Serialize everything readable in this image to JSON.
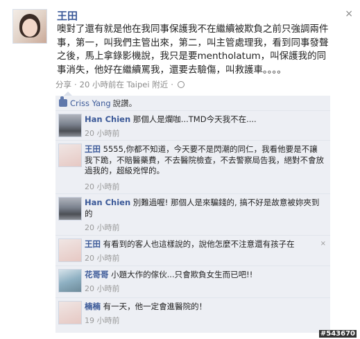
{
  "post": {
    "author": "王田",
    "body": "噢對了還有就是他在我同事保護我不在繼續被欺負之前只強調兩件事，第一，叫我們主管出來，第二，叫主管處理我，看到同事發聲之後，馬上拿錄影機說，我只是要mentholatum，叫保護我的同事消失，他好在繼續罵我，還要去驗傷，叫救護車。。。。",
    "share_label": "分享",
    "separator": "·",
    "time": "20 小時前在 Taipei 附近",
    "close_icon": "×"
  },
  "likes": {
    "name": "Criss Yang",
    "text": "說讚。"
  },
  "comments": [
    {
      "author": "Han Chien",
      "text": "那個人是爛咖...TMD今天我不在....",
      "time": "20 小時前",
      "avatar": "road-photo"
    },
    {
      "author": "王田",
      "text": "5555,你都不知道，今天要不是閃潮的同仁，我看他要是不讓我下跪，不賠醫藥費，不去醫院檢查，不去警察局告我，絕對不會放過我的，超級兇悍的。",
      "time": "20 小時前",
      "avatar": "girl-photo"
    },
    {
      "author": "Han Chien",
      "text": "別難過喔! 那個人是來騙錢的, 搞不好是故意被妳夾到的",
      "time": "20 小時前",
      "avatar": "road-photo"
    },
    {
      "author": "王田",
      "text": "有看到的客人也這樣說的，說他怎麼不注意還有孩子在",
      "time": "20 小時前",
      "avatar": "girl-photo"
    },
    {
      "author": "花哥哥",
      "text": "小題大作的傢伙...只會欺負女生而已吧!!",
      "time": "20 小時前",
      "avatar": "blue-photo"
    },
    {
      "author": "楠楠",
      "text": "有一天，他一定會進醫院的！",
      "time": "19 小時前",
      "avatar": "girl2-photo"
    }
  ],
  "comment_close_icon": "×",
  "watermark": "#543670"
}
